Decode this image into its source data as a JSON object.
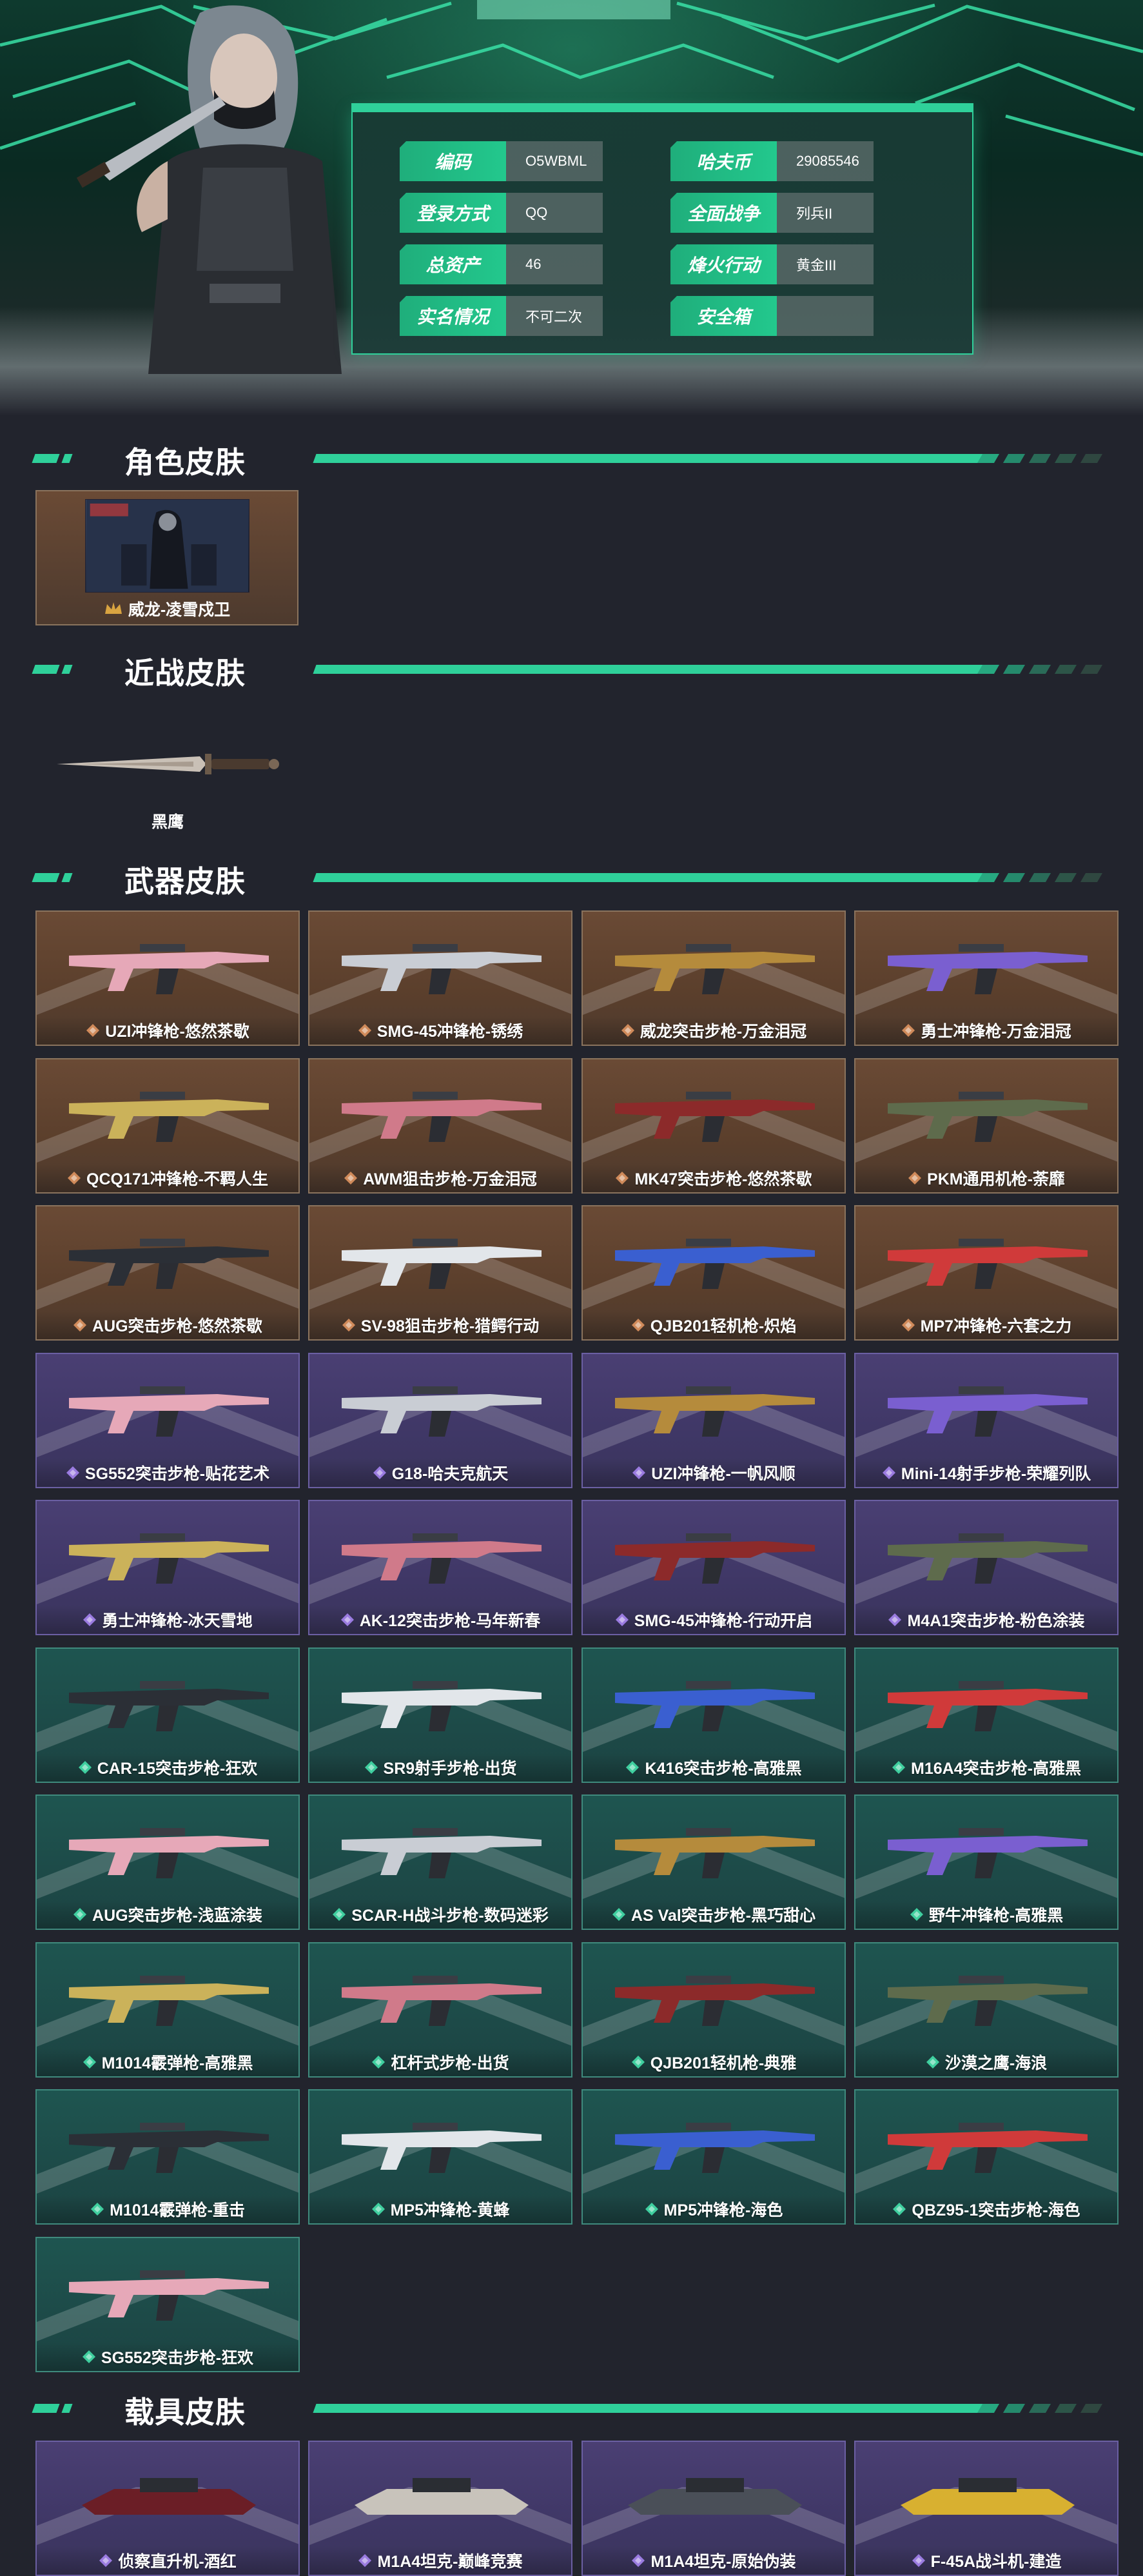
{
  "account": {
    "left_fields": [
      {
        "label": "编码",
        "value": "O5WBML"
      },
      {
        "label": "登录方式",
        "value": "QQ"
      },
      {
        "label": "总资产",
        "value": "46"
      },
      {
        "label": "实名情况",
        "value": "不可二次"
      }
    ],
    "right_fields": [
      {
        "label": "哈夫币",
        "value": "29085546"
      },
      {
        "label": "全面战争",
        "value": "列兵II"
      },
      {
        "label": "烽火行动",
        "value": "黄金III"
      },
      {
        "label": "安全箱",
        "value": ""
      }
    ]
  },
  "sections": {
    "role": {
      "title": "角色皮肤",
      "items": [
        {
          "name": "威龙-凌雪戍卫",
          "rarity": "gold",
          "icon": "character-portrait"
        }
      ]
    },
    "melee": {
      "title": "近战皮肤",
      "items": [
        {
          "name": "黑鹰",
          "icon": "knife-icon"
        }
      ]
    },
    "weapon": {
      "title": "武器皮肤",
      "items": [
        {
          "name": "UZI冲锋枪-悠然茶歇",
          "rarity": "gold"
        },
        {
          "name": "SMG-45冲锋枪-锈绣",
          "rarity": "gold"
        },
        {
          "name": "威龙突击步枪-万金泪冠",
          "rarity": "gold"
        },
        {
          "name": "勇士冲锋枪-万金泪冠",
          "rarity": "gold"
        },
        {
          "name": "QCQ171冲锋枪-不羁人生",
          "rarity": "gold"
        },
        {
          "name": "AWM狙击步枪-万金泪冠",
          "rarity": "gold"
        },
        {
          "name": "MK47突击步枪-悠然茶歇",
          "rarity": "gold"
        },
        {
          "name": "PKM通用机枪-荼靡",
          "rarity": "gold"
        },
        {
          "name": "AUG突击步枪-悠然茶歇",
          "rarity": "gold"
        },
        {
          "name": "SV-98狙击步枪-猎鳄行动",
          "rarity": "gold"
        },
        {
          "name": "QJB201轻机枪-炽焰",
          "rarity": "gold"
        },
        {
          "name": "MP7冲锋枪-六套之力",
          "rarity": "gold"
        },
        {
          "name": "SG552突击步枪-贴花艺术",
          "rarity": "purple"
        },
        {
          "name": "G18-哈夫克航天",
          "rarity": "purple"
        },
        {
          "name": "UZI冲锋枪-一帆风顺",
          "rarity": "purple"
        },
        {
          "name": "Mini-14射手步枪-荣耀列队",
          "rarity": "purple"
        },
        {
          "name": "勇士冲锋枪-冰天雪地",
          "rarity": "purple"
        },
        {
          "name": "AK-12突击步枪-马年新春",
          "rarity": "purple"
        },
        {
          "name": "SMG-45冲锋枪-行动开启",
          "rarity": "purple"
        },
        {
          "name": "M4A1突击步枪-粉色涂装",
          "rarity": "purple"
        },
        {
          "name": "CAR-15突击步枪-狂欢",
          "rarity": "green"
        },
        {
          "name": "SR9射手步枪-出货",
          "rarity": "green"
        },
        {
          "name": "K416突击步枪-高雅黑",
          "rarity": "green"
        },
        {
          "name": "M16A4突击步枪-高雅黑",
          "rarity": "green"
        },
        {
          "name": "AUG突击步枪-浅蓝涂装",
          "rarity": "green"
        },
        {
          "name": "SCAR-H战斗步枪-数码迷彩",
          "rarity": "green"
        },
        {
          "name": "AS Val突击步枪-黑巧甜心",
          "rarity": "green"
        },
        {
          "name": "野牛冲锋枪-高雅黑",
          "rarity": "green"
        },
        {
          "name": "M1014霰弹枪-高雅黑",
          "rarity": "green"
        },
        {
          "name": "杠杆式步枪-出货",
          "rarity": "green"
        },
        {
          "name": "QJB201轻机枪-典雅",
          "rarity": "green"
        },
        {
          "name": "沙漠之鹰-海浪",
          "rarity": "green"
        },
        {
          "name": "M1014霰弹枪-重击",
          "rarity": "green"
        },
        {
          "name": "MP5冲锋枪-黄蜂",
          "rarity": "green"
        },
        {
          "name": "MP5冲锋枪-海色",
          "rarity": "green"
        },
        {
          "name": "QBZ95-1突击步枪-海色",
          "rarity": "green"
        },
        {
          "name": "SG552突击步枪-狂欢",
          "rarity": "green"
        }
      ]
    },
    "vehicle": {
      "title": "载具皮肤",
      "items": [
        {
          "name": "侦察直升机-酒红",
          "rarity": "purple"
        },
        {
          "name": "M1A4坦克-巅峰竞赛",
          "rarity": "purple"
        },
        {
          "name": "M1A4坦克-原始伪装",
          "rarity": "purple"
        },
        {
          "name": "F-45A战斗机-建造",
          "rarity": "purple"
        }
      ]
    }
  },
  "colors": {
    "accent": "#2fd09a",
    "background": "#22242d",
    "rarity_gold": "#d08a5a",
    "rarity_purple": "#9a7be0",
    "rarity_green": "#3fcf9f"
  }
}
